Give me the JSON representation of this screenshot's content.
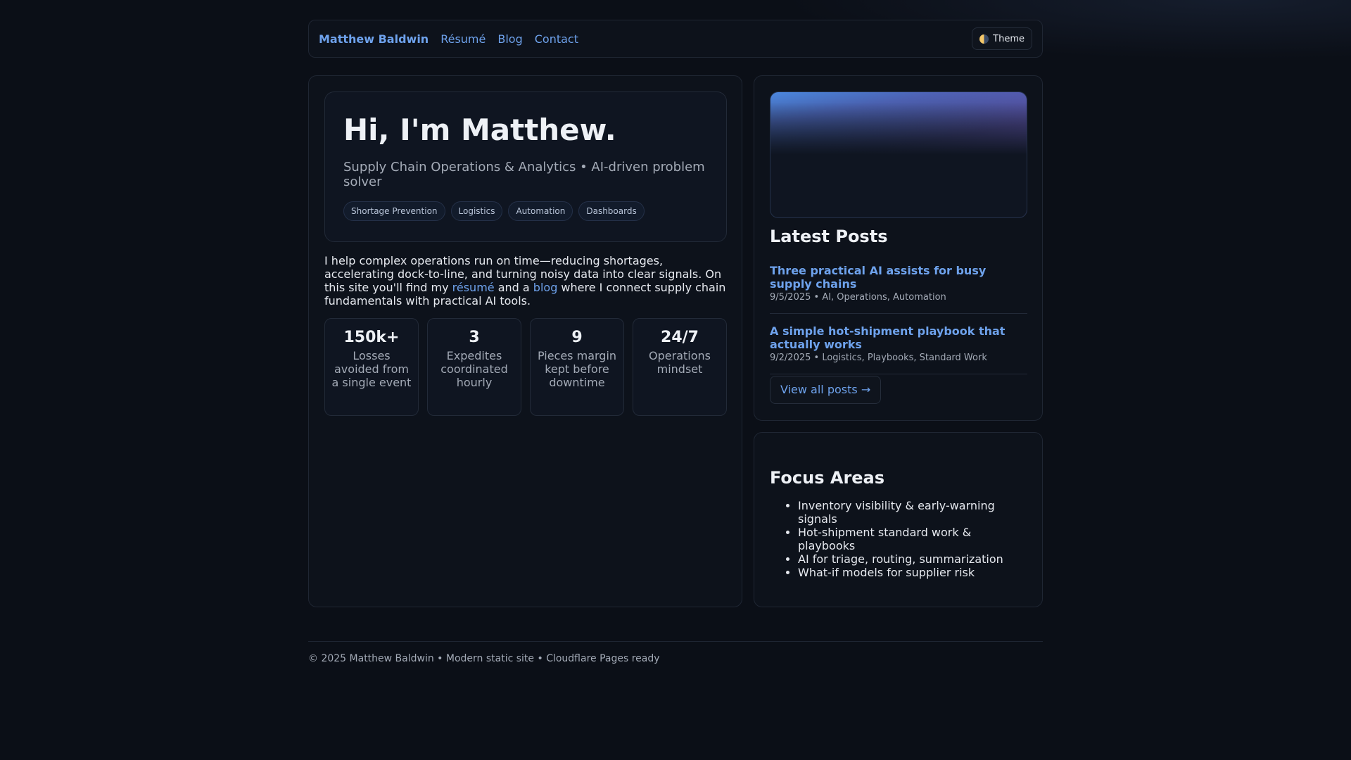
{
  "nav": {
    "brand": "Matthew Baldwin",
    "links": [
      "Résumé",
      "Blog",
      "Contact"
    ],
    "theme_label": "Theme"
  },
  "hero": {
    "title": "Hi, I'm Matthew.",
    "subtitle": "Supply Chain Operations & Analytics • AI-driven problem solver",
    "tags": [
      "Shortage Prevention",
      "Logistics",
      "Automation",
      "Dashboards"
    ]
  },
  "intro": {
    "part1": "I help complex operations run on time—reducing shortages, accelerating dock-to-line, and turning noisy data into clear signals. On this site you'll find my ",
    "link_resume": "résumé",
    "part2": " and a ",
    "link_blog": "blog",
    "part3": " where I connect supply chain fundamentals with practical AI tools."
  },
  "stats": [
    {
      "value": "150k+",
      "label": "Losses avoided from a single event"
    },
    {
      "value": "3",
      "label": "Expedites coordinated hourly"
    },
    {
      "value": "9",
      "label": "Pieces margin kept before downtime"
    },
    {
      "value": "24/7",
      "label": "Operations mindset"
    }
  ],
  "posts": {
    "heading": "Latest Posts",
    "items": [
      {
        "title": "Three practical AI assists for busy supply chains",
        "meta": "9/5/2025 • AI, Operations, Automation"
      },
      {
        "title": "A simple hot-shipment playbook that actually works",
        "meta": "9/2/2025 • Logistics, Playbooks, Standard Work"
      }
    ],
    "view_all": "View all posts →"
  },
  "focus": {
    "heading": "Focus Areas",
    "items": [
      "Inventory visibility & early-warning signals",
      "Hot-shipment standard work & playbooks",
      "AI for triage, routing, summarization",
      "What-if models for supplier risk"
    ]
  },
  "footer": {
    "text": "© 2025 Matthew Baldwin • Modern static site • Cloudflare Pages ready"
  }
}
